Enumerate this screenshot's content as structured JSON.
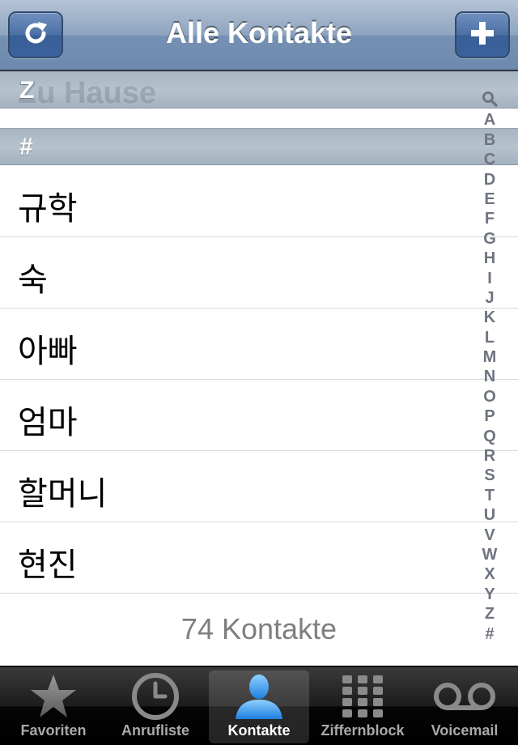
{
  "navbar": {
    "title": "Alle Kontakte",
    "left_icon": "refresh-icon",
    "right_icon": "plus-icon"
  },
  "sections": [
    {
      "label": "Z",
      "ghost_label": "Zu Hause"
    },
    {
      "label": "#"
    }
  ],
  "contacts": [
    "규학",
    "숙",
    "아빠",
    "엄마",
    "할머니",
    "현진"
  ],
  "footer": {
    "count_text": "74 Kontakte"
  },
  "index": [
    "A",
    "B",
    "C",
    "D",
    "E",
    "F",
    "G",
    "H",
    "I",
    "J",
    "K",
    "L",
    "M",
    "N",
    "O",
    "P",
    "Q",
    "R",
    "S",
    "T",
    "U",
    "V",
    "W",
    "X",
    "Y",
    "Z",
    "#"
  ],
  "index_search_icon": "search-icon",
  "tabbar": {
    "tabs": [
      {
        "label": "Favoriten",
        "icon": "star-icon",
        "active": false
      },
      {
        "label": "Anrufliste",
        "icon": "clock-icon",
        "active": false
      },
      {
        "label": "Kontakte",
        "icon": "person-icon",
        "active": true
      },
      {
        "label": "Ziffernblock",
        "icon": "keypad-icon",
        "active": false
      },
      {
        "label": "Voicemail",
        "icon": "voicemail-icon",
        "active": false
      }
    ]
  },
  "colors": {
    "nav_accent": "#6d89ad",
    "active_tab_icon": "#3b9bf0",
    "index_text": "#6e7480"
  }
}
